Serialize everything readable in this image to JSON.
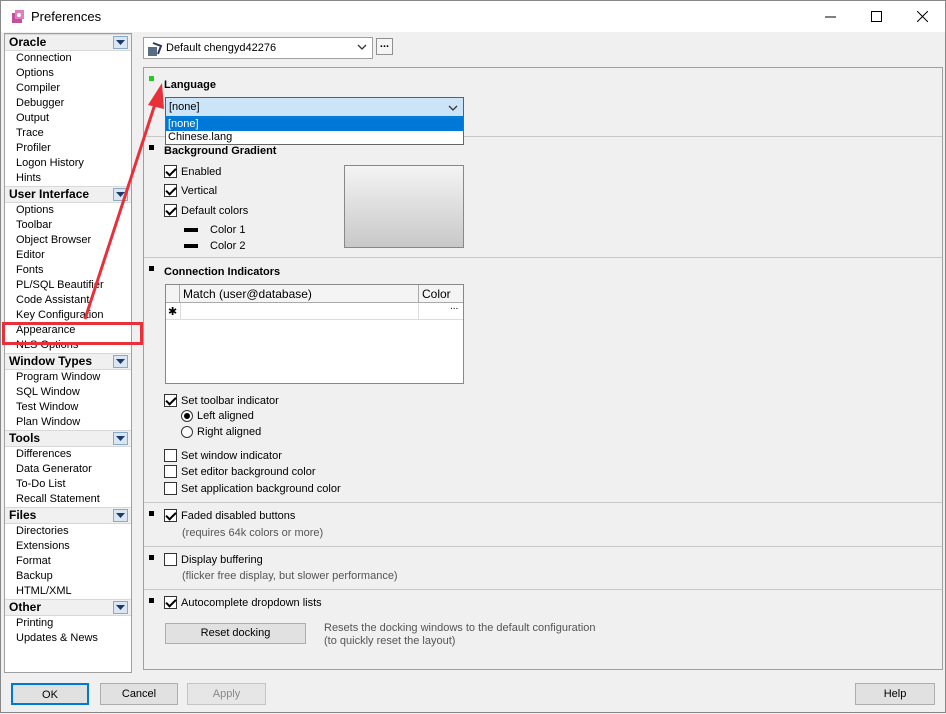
{
  "window": {
    "title": "Preferences",
    "minimize": "─",
    "maximize": "☐",
    "close": "✕"
  },
  "sidebar": {
    "groups": [
      {
        "label": "Oracle",
        "items": [
          "Connection",
          "Options",
          "Compiler",
          "Debugger",
          "Output",
          "Trace",
          "Profiler",
          "Logon History",
          "Hints"
        ]
      },
      {
        "label": "User Interface",
        "items": [
          "Options",
          "Toolbar",
          "Object Browser",
          "Editor",
          "Fonts",
          "PL/SQL Beautifier",
          "Code Assistant",
          "Key Configuration",
          "Appearance",
          "NLS Options"
        ]
      },
      {
        "label": "Window Types",
        "items": [
          "Program Window",
          "SQL Window",
          "Test Window",
          "Plan Window"
        ]
      },
      {
        "label": "Tools",
        "items": [
          "Differences",
          "Data Generator",
          "To-Do List",
          "Recall Statement"
        ]
      },
      {
        "label": "Files",
        "items": [
          "Directories",
          "Extensions",
          "Format",
          "Backup",
          "HTML/XML"
        ]
      },
      {
        "label": "Other",
        "items": [
          "Printing",
          "Updates & News"
        ]
      }
    ],
    "selected": "Appearance"
  },
  "profile": {
    "value": "Default chengyd42276",
    "dots": "..."
  },
  "language": {
    "title": "Language",
    "value": "[none]",
    "options": [
      "[none]",
      "Chinese.lang"
    ]
  },
  "gradient": {
    "title": "Background Gradient",
    "enabled": "Enabled",
    "vertical": "Vertical",
    "default_colors": "Default colors",
    "color1": "Color 1",
    "color2": "Color 2"
  },
  "conn": {
    "title": "Connection Indicators",
    "col_match": "Match (user@database)",
    "col_color": "Color",
    "row_marker": "✱",
    "row_dots": "...",
    "toolbar": "Set toolbar indicator",
    "left": "Left aligned",
    "right": "Right aligned",
    "window": "Set window indicator",
    "editor": "Set editor background color",
    "app": "Set application background color"
  },
  "faded": {
    "label": "Faded disabled buttons",
    "note": "(requires 64k colors or more)"
  },
  "buffering": {
    "label": "Display buffering",
    "note": "(flicker free display, but slower performance)"
  },
  "autocomplete": {
    "label": "Autocomplete dropdown lists"
  },
  "reset": {
    "button": "Reset docking",
    "note1": "Resets the docking windows to the default configuration",
    "note2": "(to quickly reset the layout)"
  },
  "buttons": {
    "ok": "OK",
    "cancel": "Cancel",
    "apply": "Apply",
    "help": "Help"
  },
  "colors": {
    "accent": "#0078d7",
    "highlight": "#e8303a",
    "bullet_active": "#22cc22"
  }
}
